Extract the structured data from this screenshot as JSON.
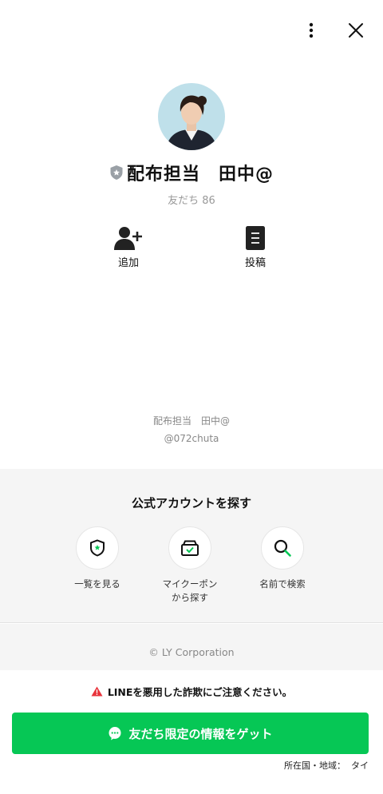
{
  "header": {
    "more_icon": "more-vertical-icon",
    "close_icon": "close-icon"
  },
  "profile": {
    "name": "配布担当　田中@",
    "friends": "友だち 86",
    "badge_icon": "shield-star-icon",
    "avatar": "profile-photo"
  },
  "actions": [
    {
      "label": "追加",
      "icon": "add-friend-icon"
    },
    {
      "label": "投稿",
      "icon": "post-icon"
    }
  ],
  "account": {
    "name": "配布担当　田中@",
    "id": "@072chuta"
  },
  "discover": {
    "title": "公式アカウントを探す",
    "items": [
      {
        "label": "一覧を見る",
        "icon": "shield-star-icon"
      },
      {
        "label": "マイクーポン\nから探す",
        "icon": "coupon-box-icon"
      },
      {
        "label": "名前で検索",
        "icon": "search-icon"
      }
    ]
  },
  "footer": {
    "copyright": "© LY Corporation"
  },
  "bottom": {
    "warning": "LINEを悪用した詐欺にご注意ください。",
    "cta_label": "友だち限定の情報をゲット",
    "region": "所在国・地域：  タイ"
  },
  "colors": {
    "accent": "#06c755",
    "warning": "#e8333b"
  }
}
